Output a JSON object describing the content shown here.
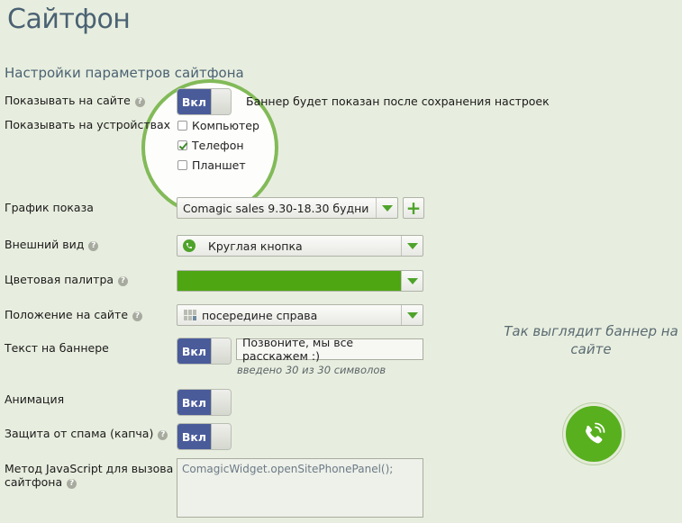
{
  "page": {
    "title": "Сайтфон",
    "section_title": "Настройки параметров сайтфона"
  },
  "show_on_site": {
    "label": "Показывать на сайте",
    "toggle": "Вкл",
    "note": "Баннер будет показан после сохранения настроек"
  },
  "devices": {
    "label": "Показывать на устройствах",
    "options": [
      {
        "label": "Компьютер",
        "checked": false
      },
      {
        "label": "Телефон",
        "checked": true
      },
      {
        "label": "Планшет",
        "checked": false
      }
    ]
  },
  "schedule": {
    "label": "График показа",
    "value": "Comagic sales 9.30-18.30 будни",
    "add": "+"
  },
  "appearance": {
    "label": "Внешний вид",
    "value": "Круглая кнопка"
  },
  "palette": {
    "label": "Цветовая палитра",
    "color": "#4ea612"
  },
  "position": {
    "label": "Положение на сайте",
    "value": "посередине справа"
  },
  "banner_text": {
    "label": "Текст на баннере",
    "toggle": "Вкл",
    "value": "Позвоните, мы все расскажем :)",
    "hint": "введено 30 из 30 символов"
  },
  "animation": {
    "label": "Анимация",
    "toggle": "Вкл"
  },
  "spam": {
    "label": "Защита от спама (капча)",
    "toggle": "Вкл"
  },
  "js_method": {
    "label_line1": "Метод JavaScript для вызова",
    "label_line2": "сайтфона",
    "value": "ComagicWidget.openSitePhonePanel();"
  },
  "preview": {
    "line1": "Так выглядит баннер на",
    "line2": "сайте"
  },
  "icons": {
    "help": "help-icon",
    "phone": "phone-icon",
    "dropdown": "chevron-down-icon",
    "plus": "plus-icon",
    "check": "check-icon"
  },
  "colors": {
    "accent": "#4ea32a",
    "toggle_on": "#4a5b9a",
    "title": "#4a6273"
  }
}
